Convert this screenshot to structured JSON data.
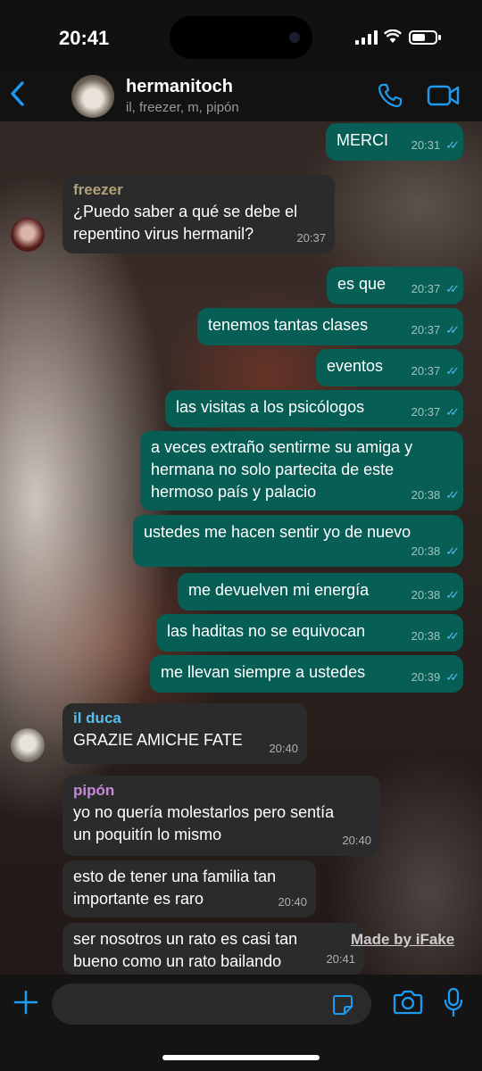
{
  "status_bar": {
    "time": "20:41"
  },
  "header": {
    "title": "hermanitoch",
    "subtitle": "il, freezer, m, pipón",
    "back_icon": "chevron-left-icon",
    "call_icon": "phone-icon",
    "video_icon": "video-camera-icon"
  },
  "messages": [
    {
      "dir": "out",
      "text": "MERCI",
      "time": "20:31",
      "read": true
    },
    {
      "dir": "in",
      "sender": "freezer",
      "sender_color": "#b0a27a",
      "text": "¿Puedo saber a qué se debe el\nrepentino virus hermanil?",
      "time": "20:37"
    },
    {
      "dir": "out",
      "text": "es que",
      "time": "20:37",
      "read": true
    },
    {
      "dir": "out",
      "text": "tenemos tantas clases",
      "time": "20:37",
      "read": true
    },
    {
      "dir": "out",
      "text": "eventos",
      "time": "20:37",
      "read": true
    },
    {
      "dir": "out",
      "text": "las visitas a los psicólogos",
      "time": "20:37",
      "read": true
    },
    {
      "dir": "out",
      "text": "a veces extraño sentirme su amiga y\nhermana no solo partecita de este\nhermoso país y palacio",
      "time": "20:38",
      "read": true
    },
    {
      "dir": "out",
      "text": "ustedes me hacen sentir yo de nuevo",
      "time": "20:38",
      "read": true
    },
    {
      "dir": "out",
      "text": "me devuelven mi energía",
      "time": "20:38",
      "read": true
    },
    {
      "dir": "out",
      "text": "las haditas no se equivocan",
      "time": "20:38",
      "read": true
    },
    {
      "dir": "out",
      "text": "me llevan siempre a ustedes",
      "time": "20:39",
      "read": true
    },
    {
      "dir": "in",
      "sender": "il duca",
      "sender_color": "#53bdeb",
      "text": "GRAZIE AMICHE FATE",
      "time": "20:40"
    },
    {
      "dir": "in",
      "sender": "pipón",
      "sender_color": "#c38ad6",
      "text": "yo no quería molestarlos pero sentía\nun poquitín lo mismo",
      "time": "20:40"
    },
    {
      "dir": "in",
      "text": "esto de tener una familia tan\nimportante es raro",
      "time": "20:40"
    },
    {
      "dir": "in",
      "text": "ser nosotros un rato es casi tan\nbueno como un rato bailando",
      "time": "20:41"
    }
  ],
  "watermark": "Made by iFake",
  "input_bar": {
    "plus_icon": "plus-icon",
    "sticker_icon": "sticker-icon",
    "camera_icon": "camera-icon",
    "mic_icon": "microphone-icon"
  }
}
